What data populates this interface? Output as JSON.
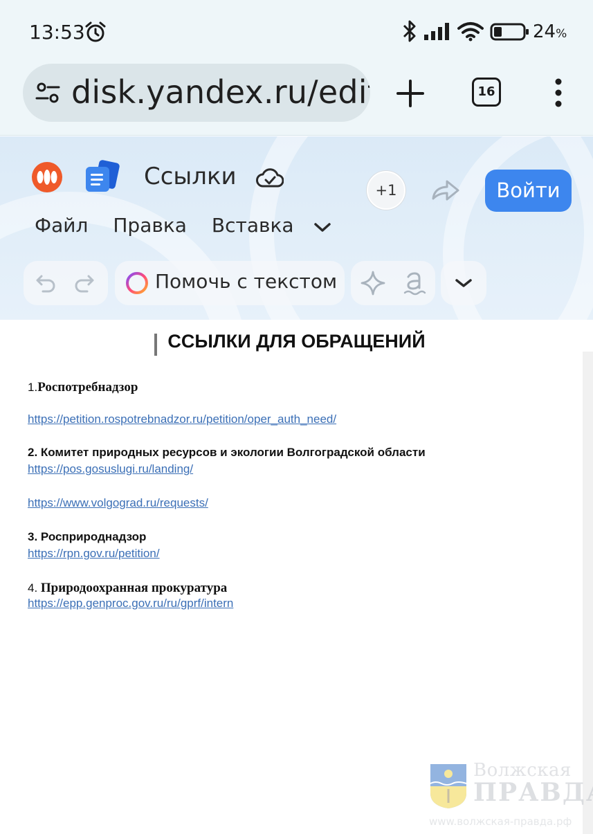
{
  "status_bar": {
    "time": "13:53",
    "battery_percent": "24",
    "battery_unit": "%",
    "icons": [
      "alarm-icon",
      "bluetooth-icon",
      "signal-icon",
      "wifi-icon",
      "battery-icon"
    ]
  },
  "browser": {
    "url": "disk.yandex.ru/edit/",
    "tab_count": "16",
    "icons": [
      "tune-icon",
      "new-tab-icon",
      "tabs-icon",
      "menu-icon"
    ]
  },
  "editor": {
    "title": "Ссылки",
    "collaborators_badge": "+1",
    "login_label": "Войти",
    "menu": [
      "Файл",
      "Правка",
      "Вставка"
    ],
    "help_label": "Помочь с текстом",
    "colors": {
      "login_button": "#3d86ee",
      "header_bg": "#dbeaf7"
    }
  },
  "document": {
    "heading": "ССЫЛКИ ДЛЯ ОБРАЩЕНИЙ",
    "s1_num": "1.",
    "s1_title": "Роспотребнадзор",
    "s1_link1": "https://petition.rospotrebnadzor.ru/petition/oper_auth_need/",
    "s2_title": "2. Комитет природных ресурсов и экологии Волгоградской области",
    "s2_link1": "https://pos.gosuslugi.ru/landing/",
    "s2_link2": "https://www.volgograd.ru/requests/",
    "s3_title": "3. Росприроднадзор",
    "s3_link1": "https://rpn.gov.ru/petition/",
    "s4_num": "4. ",
    "s4_title": "Природоохранная прокуратура",
    "s4_link1": "https://epp.genproc.gov.ru/ru/gprf/intern",
    "link_color": "#3b6fb6"
  },
  "watermark": {
    "line1": "Волжская",
    "line2": "ПРАВДА",
    "url": "www.волжская-правда.рф"
  }
}
